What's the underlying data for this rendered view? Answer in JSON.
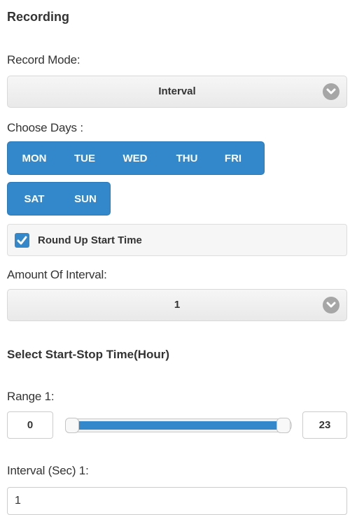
{
  "section": {
    "title": "Recording"
  },
  "record_mode": {
    "label": "Record Mode:",
    "value": "Interval"
  },
  "days": {
    "label": "Choose Days :",
    "row1": [
      "MON",
      "TUE",
      "WED",
      "THU",
      "FRI"
    ],
    "row2": [
      "SAT",
      "SUN"
    ],
    "accent_color": "#3388cc"
  },
  "round_up": {
    "label": "Round Up Start Time",
    "checked": true
  },
  "interval_amount": {
    "label": "Amount Of Interval:",
    "value": "1"
  },
  "time_section": {
    "title": "Select Start-Stop Time(Hour)"
  },
  "range1": {
    "label": "Range 1:",
    "start": "0",
    "end": "23",
    "min": 0,
    "max": 23
  },
  "interval_sec": {
    "label": "Interval (Sec) 1:",
    "value": "1"
  },
  "icons": {
    "dropdown": "chevron-down-icon",
    "check": "check-icon"
  }
}
